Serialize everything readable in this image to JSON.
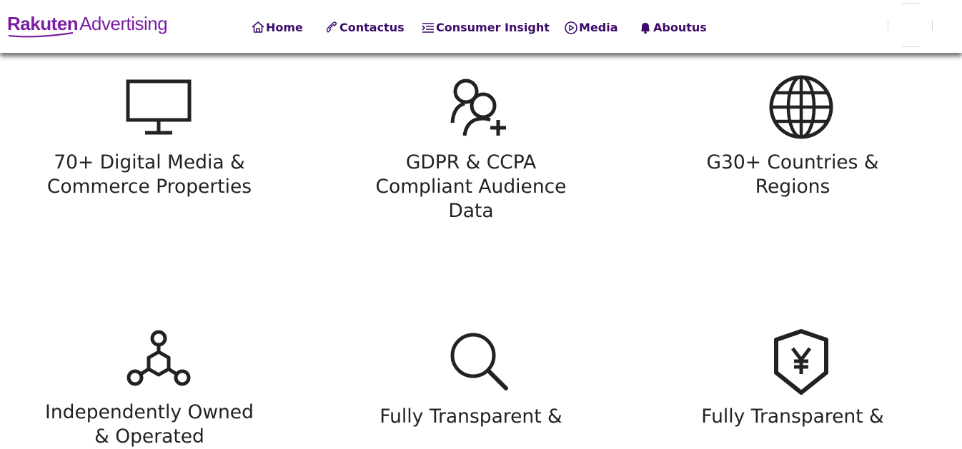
{
  "brand": {
    "name_bold": "Rakuten",
    "name_light": "Advertising",
    "color": "#7b1fa2"
  },
  "nav": {
    "color": "#3d0a6b",
    "items": [
      {
        "label": "Home",
        "icon": "home-icon"
      },
      {
        "label": "Contactus",
        "icon": "phone-icon"
      },
      {
        "label": "Consumer Insight",
        "icon": "list-icon"
      },
      {
        "label": "Media",
        "icon": "play-circle-icon"
      },
      {
        "label": "Aboutus",
        "icon": "bell-icon"
      }
    ]
  },
  "features": [
    {
      "icon": "monitor-icon",
      "label_lines": [
        "70+ Digital Media &",
        "Commerce Properties"
      ]
    },
    {
      "icon": "add-user-icon",
      "label_lines": [
        "GDPR & CCPA",
        "Compliant Audience",
        "Data"
      ]
    },
    {
      "icon": "globe-icon",
      "label_lines": [
        "G30+ Countries &",
        "Regions"
      ]
    },
    {
      "icon": "network-icon",
      "label_lines": [
        "Independently Owned",
        "& Operated"
      ]
    },
    {
      "icon": "search-icon",
      "label_lines": [
        "Fully Transparent &"
      ]
    },
    {
      "icon": "yen-shield-icon",
      "label_lines": [
        "Fully Transparent &"
      ]
    }
  ]
}
